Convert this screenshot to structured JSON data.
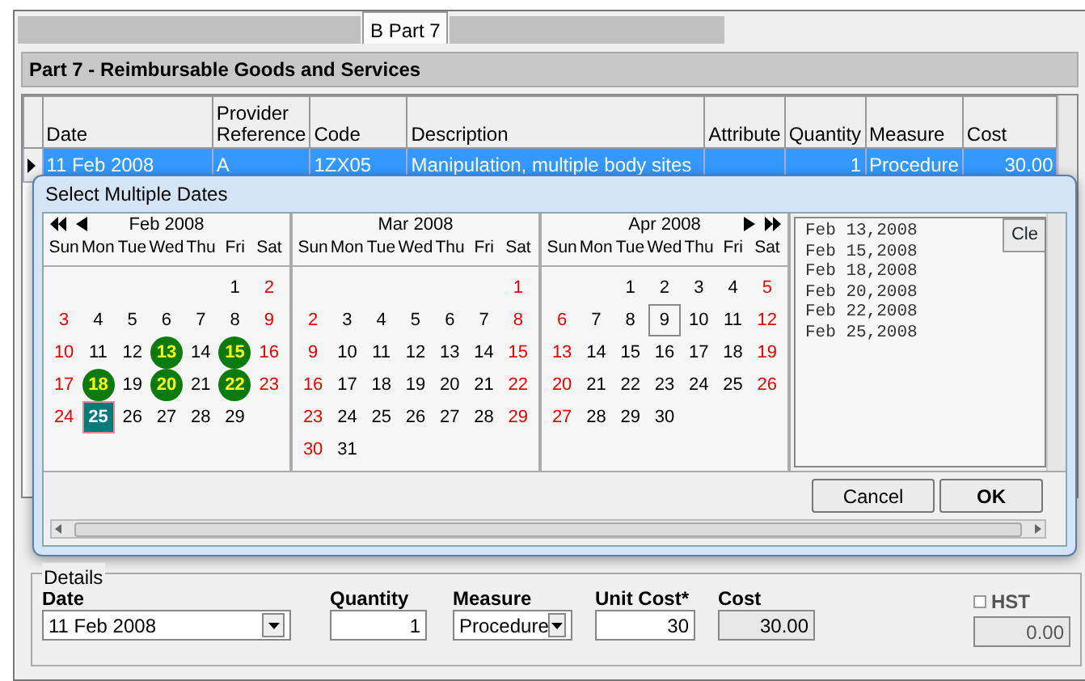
{
  "tabs": [
    {
      "label": "B Part 7",
      "selected": true
    }
  ],
  "section_title": "Part 7 - Reimbursable Goods and Services",
  "table": {
    "columns": [
      "Date",
      "Provider Reference",
      "Code",
      "Description",
      "Attribute",
      "Quantity",
      "Measure",
      "Cost"
    ],
    "rows": [
      {
        "selected": true,
        "cells": [
          "11 Feb 2008",
          "A",
          "1ZX05",
          "Manipulation, multiple body sites",
          "",
          "1",
          "Procedure",
          "30.00"
        ]
      }
    ]
  },
  "dialog": {
    "title": "Select Multiple Dates",
    "months": [
      {
        "title": "Feb 2008",
        "weekdays": [
          "Sun",
          "Mon",
          "Tue",
          "Wed",
          "Thu",
          "Fri",
          "Sat"
        ],
        "weeks": [
          [
            {
              "d": "1",
              "selected": false
            },
            {
              "d": "2",
              "selected": false
            }
          ],
          [
            {
              "d": "3",
              "selected": false
            },
            {
              "d": "4",
              "selected": false
            },
            {
              "d": "5",
              "selected": false
            },
            {
              "d": "6",
              "selected": false
            },
            {
              "d": "7",
              "selected": false
            },
            {
              "d": "8",
              "selected": false
            },
            {
              "d": "9",
              "selected": false
            }
          ],
          [
            {
              "d": "10",
              "selected": false
            },
            {
              "d": "11",
              "selected": false
            },
            {
              "d": "12",
              "selected": false
            },
            {
              "d": "13",
              "selected": true
            },
            {
              "d": "14",
              "selected": false
            },
            {
              "d": "15",
              "selected": true
            },
            {
              "d": "16",
              "selected": false
            }
          ],
          [
            {
              "d": "17",
              "selected": false
            },
            {
              "d": "18",
              "selected": true
            },
            {
              "d": "19",
              "selected": false
            },
            {
              "d": "20",
              "selected": true
            },
            {
              "d": "21",
              "selected": false
            },
            {
              "d": "22",
              "selected": true
            },
            {
              "d": "23",
              "selected": false
            }
          ],
          [
            {
              "d": "24",
              "selected": false
            },
            {
              "d": "25",
              "selected": true,
              "today": true
            },
            {
              "d": "26",
              "selected": false
            },
            {
              "d": "27",
              "selected": false
            },
            {
              "d": "28",
              "selected": false
            },
            {
              "d": "29",
              "selected": false
            }
          ]
        ]
      },
      {
        "title": "Mar 2008",
        "weekdays": [
          "Sun",
          "Mon",
          "Tue",
          "Wed",
          "Thu",
          "Fri",
          "Sat"
        ],
        "weeks": [
          [
            {
              "d": "1",
              "selected": false
            }
          ],
          [
            {
              "d": "2",
              "selected": false
            },
            {
              "d": "3",
              "selected": false
            },
            {
              "d": "4",
              "selected": false
            },
            {
              "d": "5",
              "selected": false
            },
            {
              "d": "6",
              "selected": false
            },
            {
              "d": "7",
              "selected": false
            },
            {
              "d": "8",
              "selected": false
            }
          ],
          [
            {
              "d": "9",
              "selected": false
            },
            {
              "d": "10",
              "selected": false
            },
            {
              "d": "11",
              "selected": false
            },
            {
              "d": "12",
              "selected": false
            },
            {
              "d": "13",
              "selected": false
            },
            {
              "d": "14",
              "selected": false
            },
            {
              "d": "15",
              "selected": false
            }
          ],
          [
            {
              "d": "16",
              "selected": false
            },
            {
              "d": "17",
              "selected": false
            },
            {
              "d": "18",
              "selected": false
            },
            {
              "d": "19",
              "selected": false
            },
            {
              "d": "20",
              "selected": false
            },
            {
              "d": "21",
              "selected": false
            },
            {
              "d": "22",
              "selected": false
            }
          ],
          [
            {
              "d": "23",
              "selected": false
            },
            {
              "d": "24",
              "selected": false
            },
            {
              "d": "25",
              "selected": false
            },
            {
              "d": "26",
              "selected": false
            },
            {
              "d": "27",
              "selected": false
            },
            {
              "d": "28",
              "selected": false
            },
            {
              "d": "29",
              "selected": false
            }
          ],
          [
            {
              "d": "30",
              "selected": false
            },
            {
              "d": "31",
              "selected": false
            }
          ]
        ]
      },
      {
        "title": "Apr 2008",
        "weekdays": [
          "Sun",
          "Mon",
          "Tue",
          "Wed",
          "Thu",
          "Fri",
          "Sat"
        ],
        "weeks": [
          [
            {
              "d": "1",
              "selected": false
            },
            {
              "d": "2",
              "selected": false
            },
            {
              "d": "3",
              "selected": false
            },
            {
              "d": "4",
              "selected": false
            },
            {
              "d": "5",
              "selected": false
            }
          ],
          [
            {
              "d": "6",
              "selected": false
            },
            {
              "d": "7",
              "selected": false
            },
            {
              "d": "8",
              "selected": false
            },
            {
              "d": "9",
              "selected": false,
              "focused": true
            },
            {
              "d": "10",
              "selected": false
            },
            {
              "d": "11",
              "selected": false
            },
            {
              "d": "12",
              "selected": false
            }
          ],
          [
            {
              "d": "13",
              "selected": false
            },
            {
              "d": "14",
              "selected": false
            },
            {
              "d": "15",
              "selected": false
            },
            {
              "d": "16",
              "selected": false
            },
            {
              "d": "17",
              "selected": false
            },
            {
              "d": "18",
              "selected": false
            },
            {
              "d": "19",
              "selected": false
            }
          ],
          [
            {
              "d": "20",
              "selected": false
            },
            {
              "d": "21",
              "selected": false
            },
            {
              "d": "22",
              "selected": false
            },
            {
              "d": "23",
              "selected": false
            },
            {
              "d": "24",
              "selected": false
            },
            {
              "d": "25",
              "selected": false
            },
            {
              "d": "26",
              "selected": false
            }
          ],
          [
            {
              "d": "27",
              "selected": false
            },
            {
              "d": "28",
              "selected": false
            },
            {
              "d": "29",
              "selected": false
            },
            {
              "d": "30",
              "selected": false
            }
          ]
        ]
      }
    ],
    "selected_dates": [
      "Feb 13,2008",
      "Feb 15,2008",
      "Feb 18,2008",
      "Feb 20,2008",
      "Feb 22,2008",
      "Feb 25,2008"
    ],
    "clear_button": "Cle",
    "buttons": [
      "Cancel",
      "OK"
    ]
  },
  "details": {
    "legend": "Details",
    "fields": [
      {
        "label": "Date",
        "kind": "combo",
        "value": "11 Feb 2008",
        "disabled": false
      },
      {
        "label": "Quantity",
        "kind": "number",
        "value": "1",
        "disabled": false
      },
      {
        "label": "Measure",
        "kind": "combo",
        "value": "Procedure",
        "disabled": false
      },
      {
        "label": "Unit Cost*",
        "kind": "number",
        "value": "30",
        "disabled": false
      },
      {
        "label": "Cost",
        "kind": "number",
        "value": "30.00",
        "disabled": true
      }
    ],
    "hst": {
      "label": "HST",
      "checked": false,
      "value": "0.00",
      "disabled": true
    }
  }
}
